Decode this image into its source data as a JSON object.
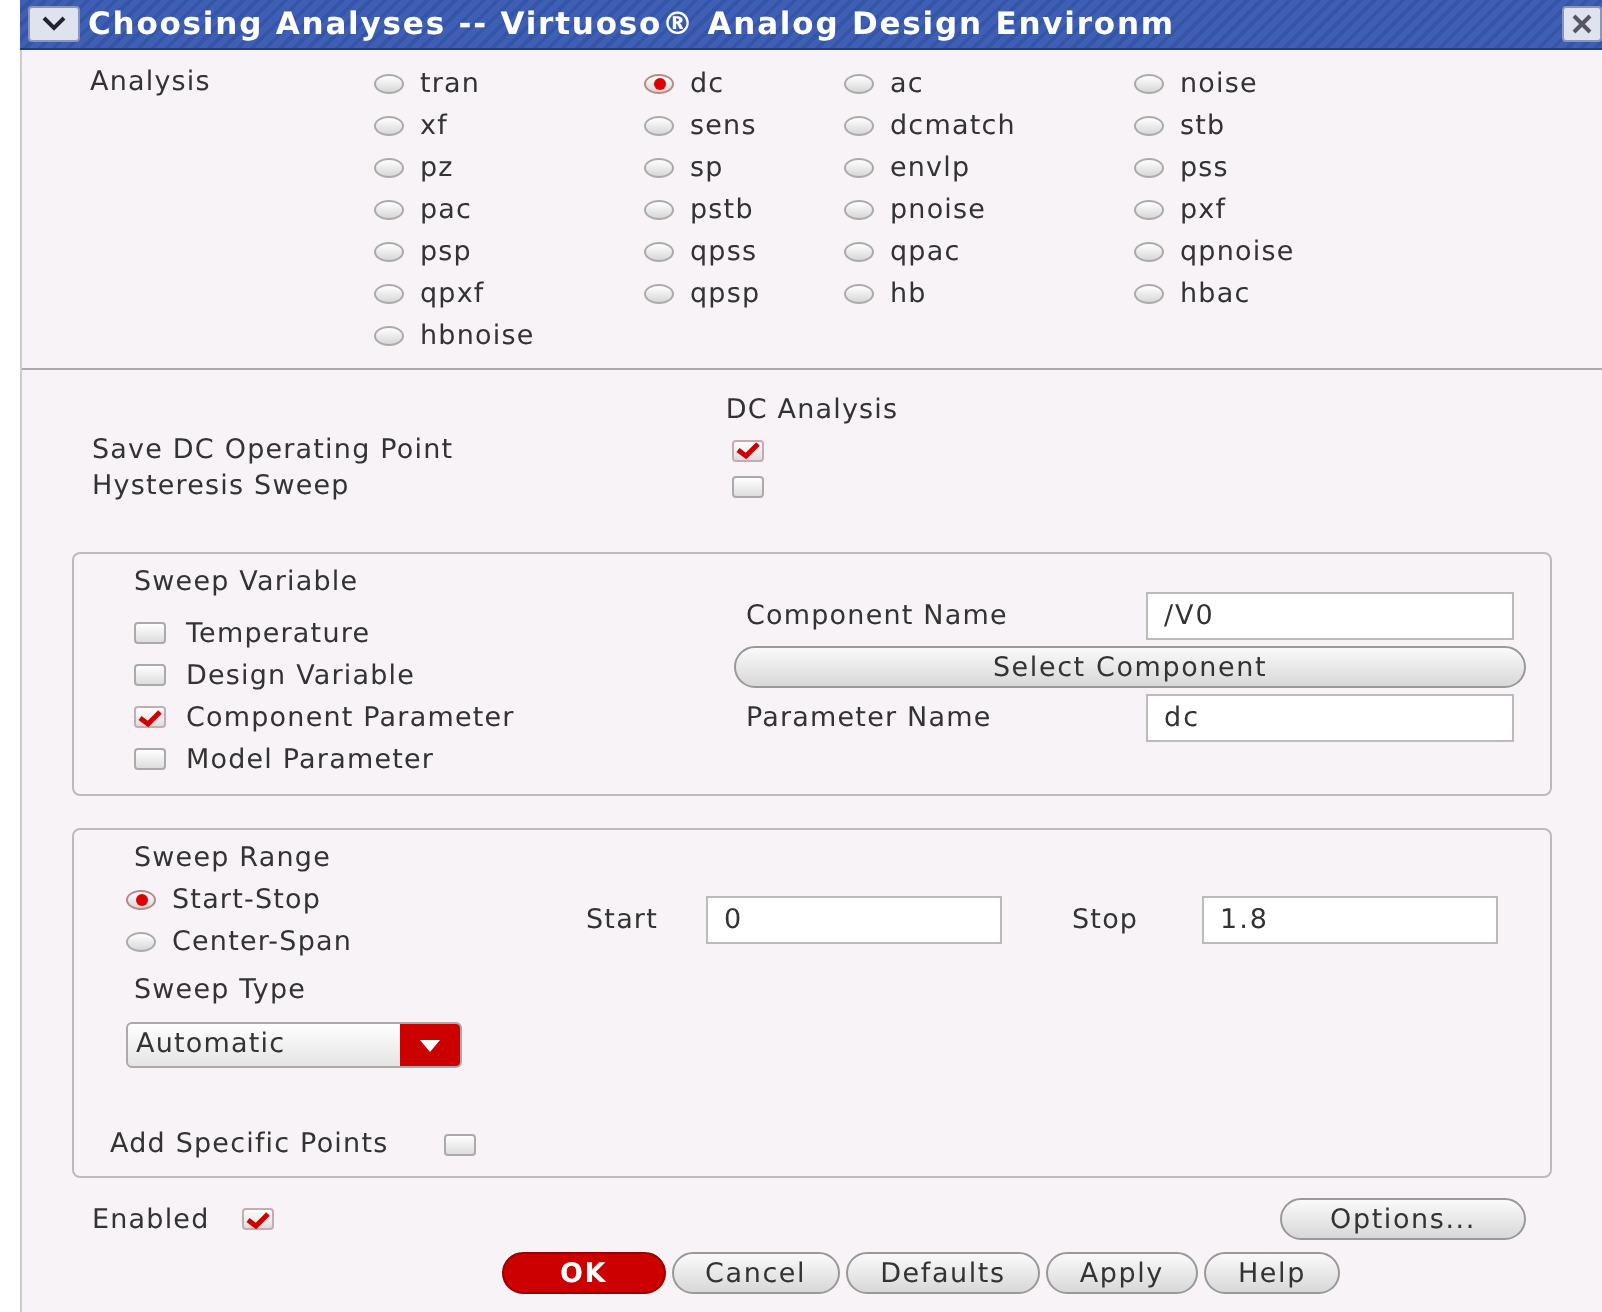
{
  "window": {
    "title": "Choosing Analyses -- Virtuoso® Analog Design Environm"
  },
  "analysis": {
    "label": "Analysis",
    "options": [
      {
        "label": "tran",
        "selected": false
      },
      {
        "label": "dc",
        "selected": true
      },
      {
        "label": "ac",
        "selected": false
      },
      {
        "label": "noise",
        "selected": false
      },
      {
        "label": "xf",
        "selected": false
      },
      {
        "label": "sens",
        "selected": false
      },
      {
        "label": "dcmatch",
        "selected": false
      },
      {
        "label": "stb",
        "selected": false
      },
      {
        "label": "pz",
        "selected": false
      },
      {
        "label": "sp",
        "selected": false
      },
      {
        "label": "envlp",
        "selected": false
      },
      {
        "label": "pss",
        "selected": false
      },
      {
        "label": "pac",
        "selected": false
      },
      {
        "label": "pstb",
        "selected": false
      },
      {
        "label": "pnoise",
        "selected": false
      },
      {
        "label": "pxf",
        "selected": false
      },
      {
        "label": "psp",
        "selected": false
      },
      {
        "label": "qpss",
        "selected": false
      },
      {
        "label": "qpac",
        "selected": false
      },
      {
        "label": "qpnoise",
        "selected": false
      },
      {
        "label": "qpxf",
        "selected": false
      },
      {
        "label": "qpsp",
        "selected": false
      },
      {
        "label": "hb",
        "selected": false
      },
      {
        "label": "hbac",
        "selected": false
      },
      {
        "label": "hbnoise",
        "selected": false
      }
    ]
  },
  "dc_analysis": {
    "title": "DC Analysis",
    "options": [
      {
        "label": "Save DC Operating Point",
        "checked": true
      },
      {
        "label": "Hysteresis Sweep",
        "checked": false
      }
    ]
  },
  "sweep_variable": {
    "title": "Sweep Variable",
    "options": [
      {
        "label": "Temperature",
        "checked": false
      },
      {
        "label": "Design Variable",
        "checked": false
      },
      {
        "label": "Component Parameter",
        "checked": true
      },
      {
        "label": "Model Parameter",
        "checked": false
      }
    ],
    "component_name": {
      "label": "Component Name",
      "value": "/V0"
    },
    "select_button": "Select Component",
    "parameter_name": {
      "label": "Parameter Name",
      "value": "dc"
    }
  },
  "sweep_range": {
    "title": "Sweep Range",
    "modes": [
      {
        "label": "Start-Stop",
        "selected": true
      },
      {
        "label": "Center-Span",
        "selected": false
      }
    ],
    "start": {
      "label": "Start",
      "value": "0"
    },
    "stop": {
      "label": "Stop",
      "value": "1.8"
    },
    "sweep_type": {
      "label": "Sweep Type",
      "value": "Automatic"
    },
    "add_specific_points": {
      "label": "Add Specific Points",
      "checked": false
    }
  },
  "enabled": {
    "label": "Enabled",
    "checked": true
  },
  "options_button": "Options...",
  "buttons": [
    {
      "label": "OK",
      "kind": "primary"
    },
    {
      "label": "Cancel",
      "kind": "normal"
    },
    {
      "label": "Defaults",
      "kind": "normal"
    },
    {
      "label": "Apply",
      "kind": "normal"
    },
    {
      "label": "Help",
      "kind": "normal"
    }
  ]
}
